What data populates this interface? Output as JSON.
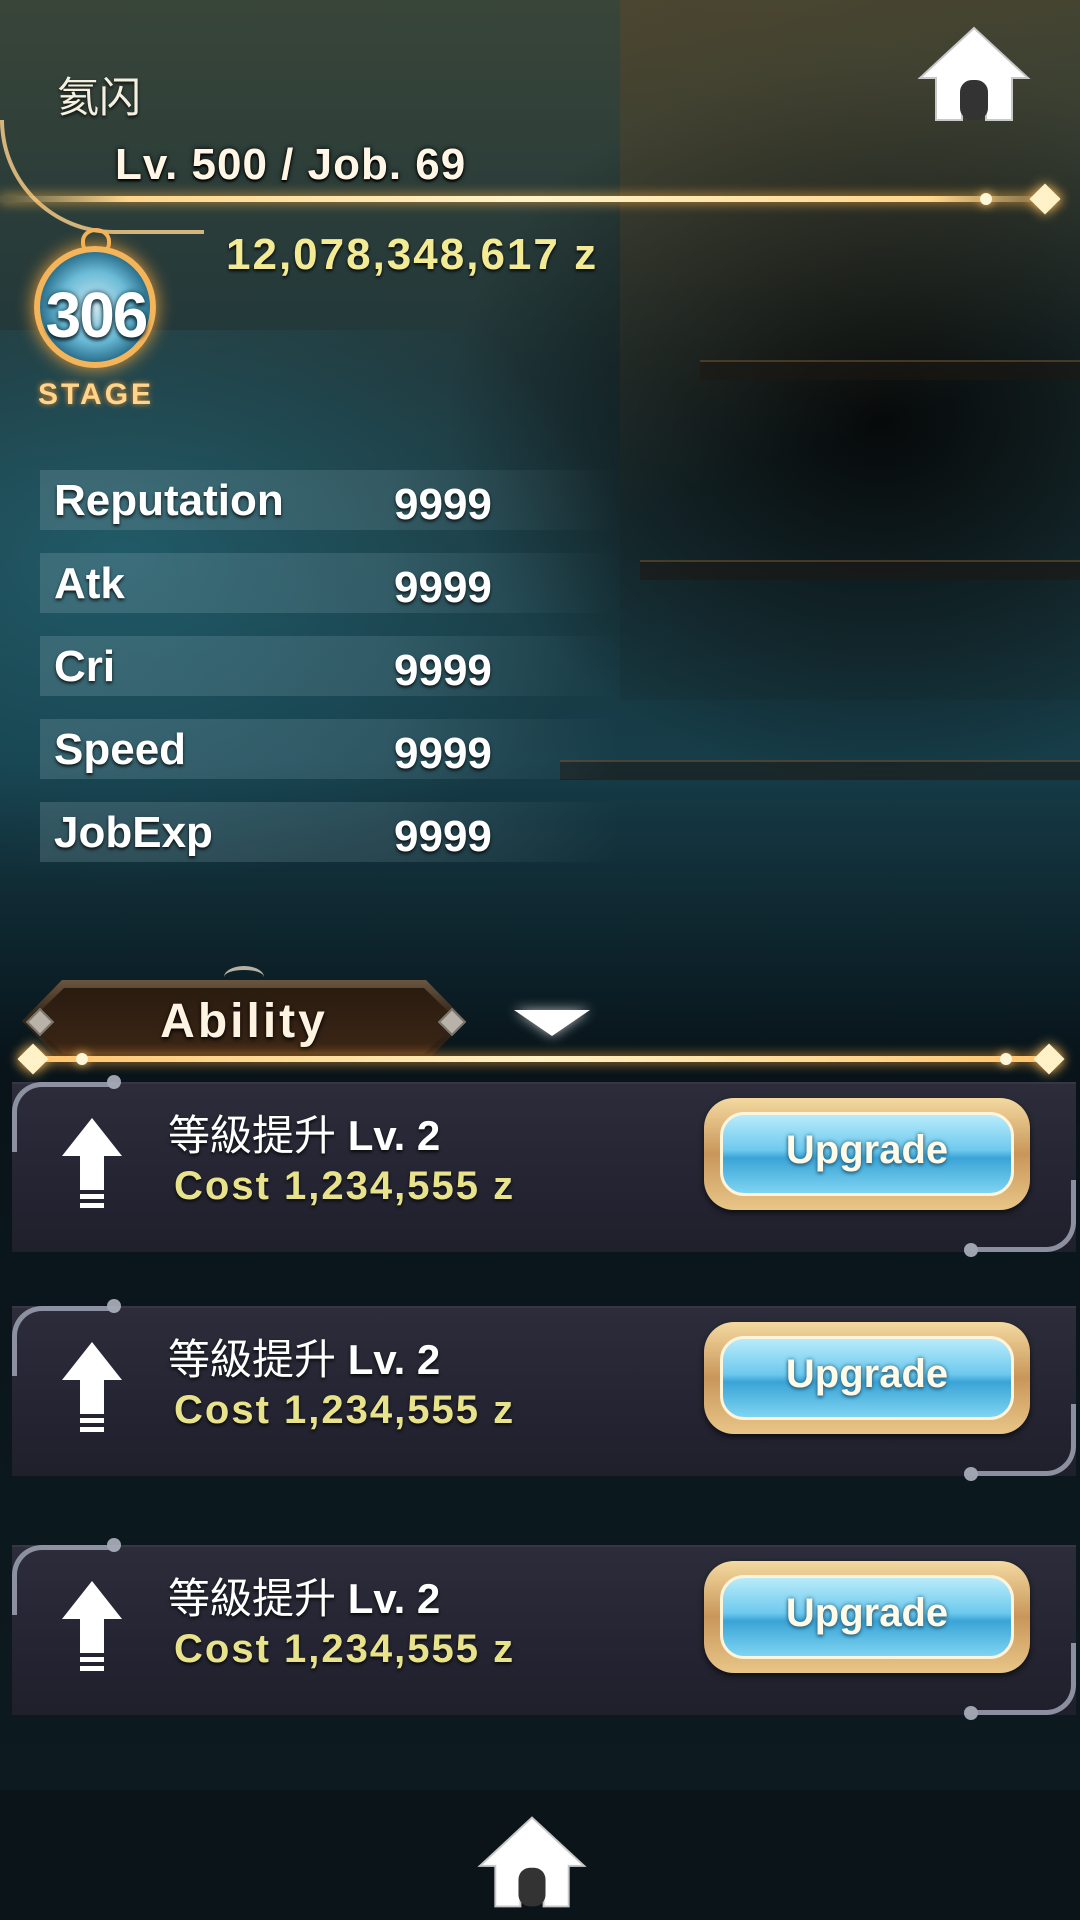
{
  "player": {
    "name": "氦闪",
    "level_text": "Lv. 500 / Job. 69",
    "zeny": "12,078,348,617 z"
  },
  "stage": {
    "number": "306",
    "label": "STAGE"
  },
  "stats": [
    {
      "label": "Reputation",
      "value": "9999"
    },
    {
      "label": "Atk",
      "value": "9999"
    },
    {
      "label": "Cri",
      "value": "9999"
    },
    {
      "label": "Speed",
      "value": "9999"
    },
    {
      "label": "JobExp",
      "value": "9999"
    }
  ],
  "ability": {
    "tab_label": "Ability",
    "items": [
      {
        "name": "等級提升",
        "level": "Lv. 2",
        "cost": "Cost 1,234,555 z",
        "button": "Upgrade"
      },
      {
        "name": "等級提升",
        "level": "Lv. 2",
        "cost": "Cost 1,234,555 z",
        "button": "Upgrade"
      },
      {
        "name": "等級提升",
        "level": "Lv. 2",
        "cost": "Cost 1,234,555 z",
        "button": "Upgrade"
      }
    ]
  },
  "icons": {
    "home_top": "home-icon",
    "home_bottom": "home-icon",
    "collapse": "chevron-down-icon",
    "upgrade_arrow": "arrow-up-icon"
  },
  "colors": {
    "accent_gold": "#ffd58a",
    "zeny_text": "#f3ea94",
    "cost_text": "#e8e38a",
    "button_blue": "#6ec9ee"
  }
}
